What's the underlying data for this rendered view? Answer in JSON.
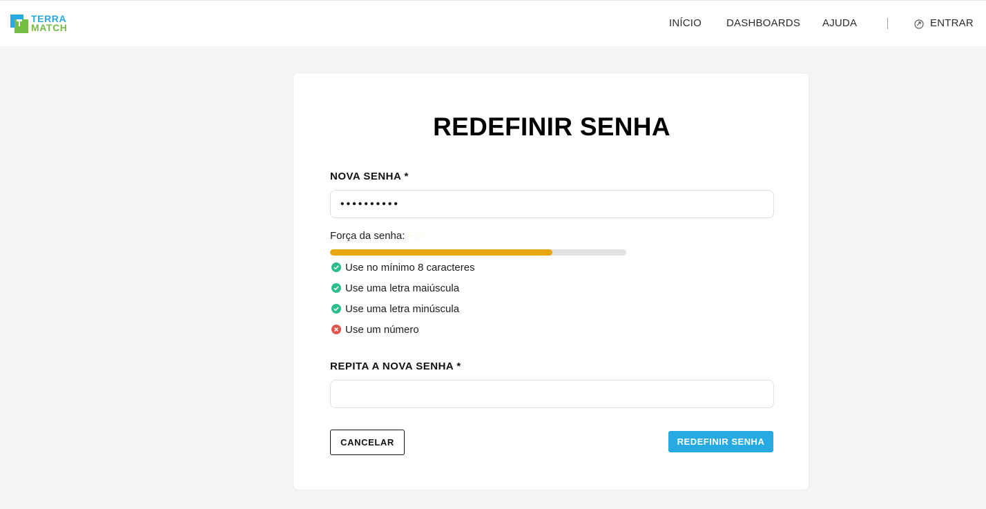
{
  "header": {
    "logo": {
      "line1": "TERRA",
      "line2": "MATCH"
    },
    "nav": [
      {
        "label": "INÍCIO"
      },
      {
        "label": "DASHBOARDS"
      },
      {
        "label": "AJUDA"
      }
    ],
    "login_label": "ENTRAR",
    "login_icon": "login-arrow-icon"
  },
  "form": {
    "title": "REDEFINIR SENHA",
    "new_password": {
      "label": "NOVA SENHA *",
      "value": "••••••••••"
    },
    "strength": {
      "label": "Força da senha:",
      "value": "Fair",
      "level": 0.75,
      "color": "#e9a60b"
    },
    "requirements": [
      {
        "text": "Use no mínimo 8 caracteres",
        "met": true,
        "icon": "check-circle-icon"
      },
      {
        "text": "Use uma letra maiúscula",
        "met": true,
        "icon": "check-circle-icon"
      },
      {
        "text": "Use uma letra minúscula",
        "met": true,
        "icon": "check-circle-icon"
      },
      {
        "text": "Use um número",
        "met": false,
        "icon": "x-circle-icon"
      }
    ],
    "repeat_password": {
      "label": "REPITA A NOVA SENHA *",
      "value": ""
    },
    "cancel_label": "CANCELAR",
    "submit_label": "REDEFINIR SENHA"
  },
  "colors": {
    "brand_blue": "#27a9e1",
    "brand_green": "#72bf44",
    "check_green": "#2dbd8f",
    "error_red": "#e2524f"
  }
}
